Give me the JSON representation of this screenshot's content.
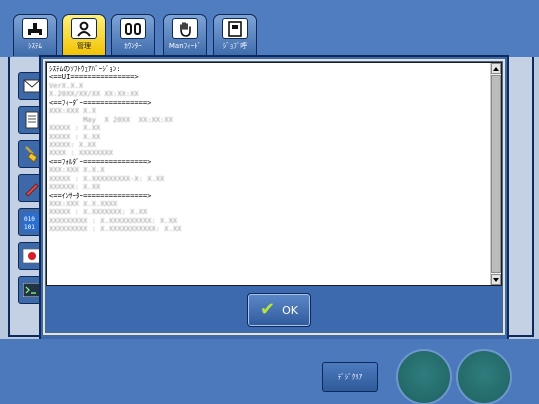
{
  "tabs": [
    {
      "label": "ｼｽﾃﾑ",
      "icon": "system-icon",
      "active": false
    },
    {
      "label": "管理",
      "icon": "user-icon",
      "active": true
    },
    {
      "label": "ｶｳﾝﾀｰ",
      "icon": "counter-icon",
      "active": false
    },
    {
      "label": "Manﾌｨｰﾄﾞ",
      "icon": "hand-icon",
      "active": false
    },
    {
      "label": "ｼﾞｮﾌﾞ呼",
      "icon": "job-icon",
      "active": false
    }
  ],
  "sidebar": [
    {
      "icon": "mail-icon"
    },
    {
      "icon": "document-icon"
    },
    {
      "icon": "broom-icon"
    },
    {
      "icon": "pencil-icon"
    },
    {
      "icon": "binary-icon"
    },
    {
      "icon": "japan-flag-icon"
    },
    {
      "icon": "terminal-icon"
    }
  ],
  "dialog": {
    "lines": [
      {
        "text": "ｼｽﾃﾑのｿﾌﾄｳｪｱﾊﾞｰｼﾞｮﾝ:",
        "blurred": false
      },
      {
        "text": "<==UI===============>",
        "blurred": false
      },
      {
        "text": "VerX.X.X",
        "blurred": true
      },
      {
        "text": "X.20XX/XX/XX XX:XX:XX",
        "blurred": true
      },
      {
        "text": "<==ﾌｨｰﾀﾞｰ===============>",
        "blurred": false
      },
      {
        "text": "XXX:XXX X.X",
        "blurred": true
      },
      {
        "text": "        May  X 20XX  XX:XX:XX",
        "blurred": true
      },
      {
        "text": "XXXXX : X.XX",
        "blurred": true
      },
      {
        "text": "XXXXX : X.XX",
        "blurred": true
      },
      {
        "text": "XXXXX: X.XX",
        "blurred": true
      },
      {
        "text": "XXXX : XXXXXXXX",
        "blurred": true
      },
      {
        "text": "<==ﾌｫﾙﾀﾞｰ===============>",
        "blurred": false
      },
      {
        "text": "XXX:XXX X.X.X",
        "blurred": true
      },
      {
        "text": "XXXXX : X.XXXXXXXXX-X: X.XX",
        "blurred": true
      },
      {
        "text": "XXXXXX: X.XX",
        "blurred": true
      },
      {
        "text": "<==ｲﾝｻｰﾀｰ===============>",
        "blurred": false
      },
      {
        "text": "XXX:XXX X.X.XXXX",
        "blurred": true
      },
      {
        "text": "XXXXX : X.XXXXXXX: X.XX",
        "blurred": true
      },
      {
        "text": "XXXXXXXXX : X.XXXXXXXXXX: X.XX",
        "blurred": true
      },
      {
        "text": "XXXXXXXXX : X.XXXXXXXXXXX: X.XX",
        "blurred": true
      }
    ],
    "ok_label": "OK"
  },
  "bottom": {
    "clear_label": "ﾃﾞｼﾞｸﾘｱ"
  }
}
